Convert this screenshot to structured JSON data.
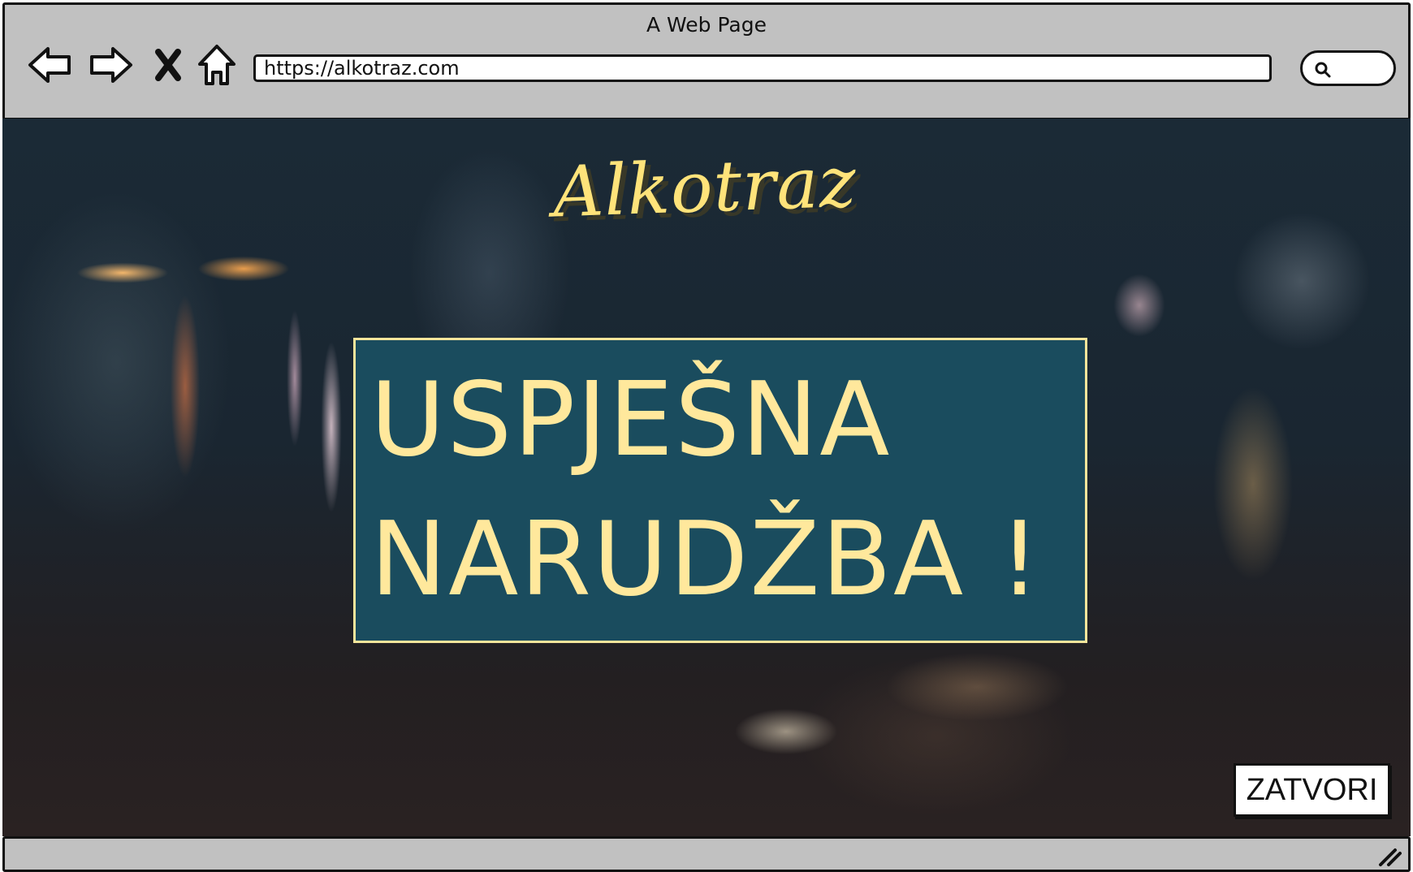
{
  "browser": {
    "window_title": "A Web Page",
    "url": "https://alkotraz.com",
    "icons": {
      "back": "arrow-left-icon",
      "forward": "arrow-right-icon",
      "stop": "close-icon",
      "home": "home-icon",
      "search": "search-icon",
      "resize": "resize-grip-icon"
    }
  },
  "page": {
    "logo": "Alkotraz",
    "message": "USPJEŠNA\nNARUDŽBA !",
    "close_label": "ZATVORI"
  },
  "colors": {
    "chrome_bg": "#c1c1c1",
    "panel_bg": "#1a4c5e",
    "panel_text": "#ffe89c",
    "logo": "#ffe37a"
  }
}
